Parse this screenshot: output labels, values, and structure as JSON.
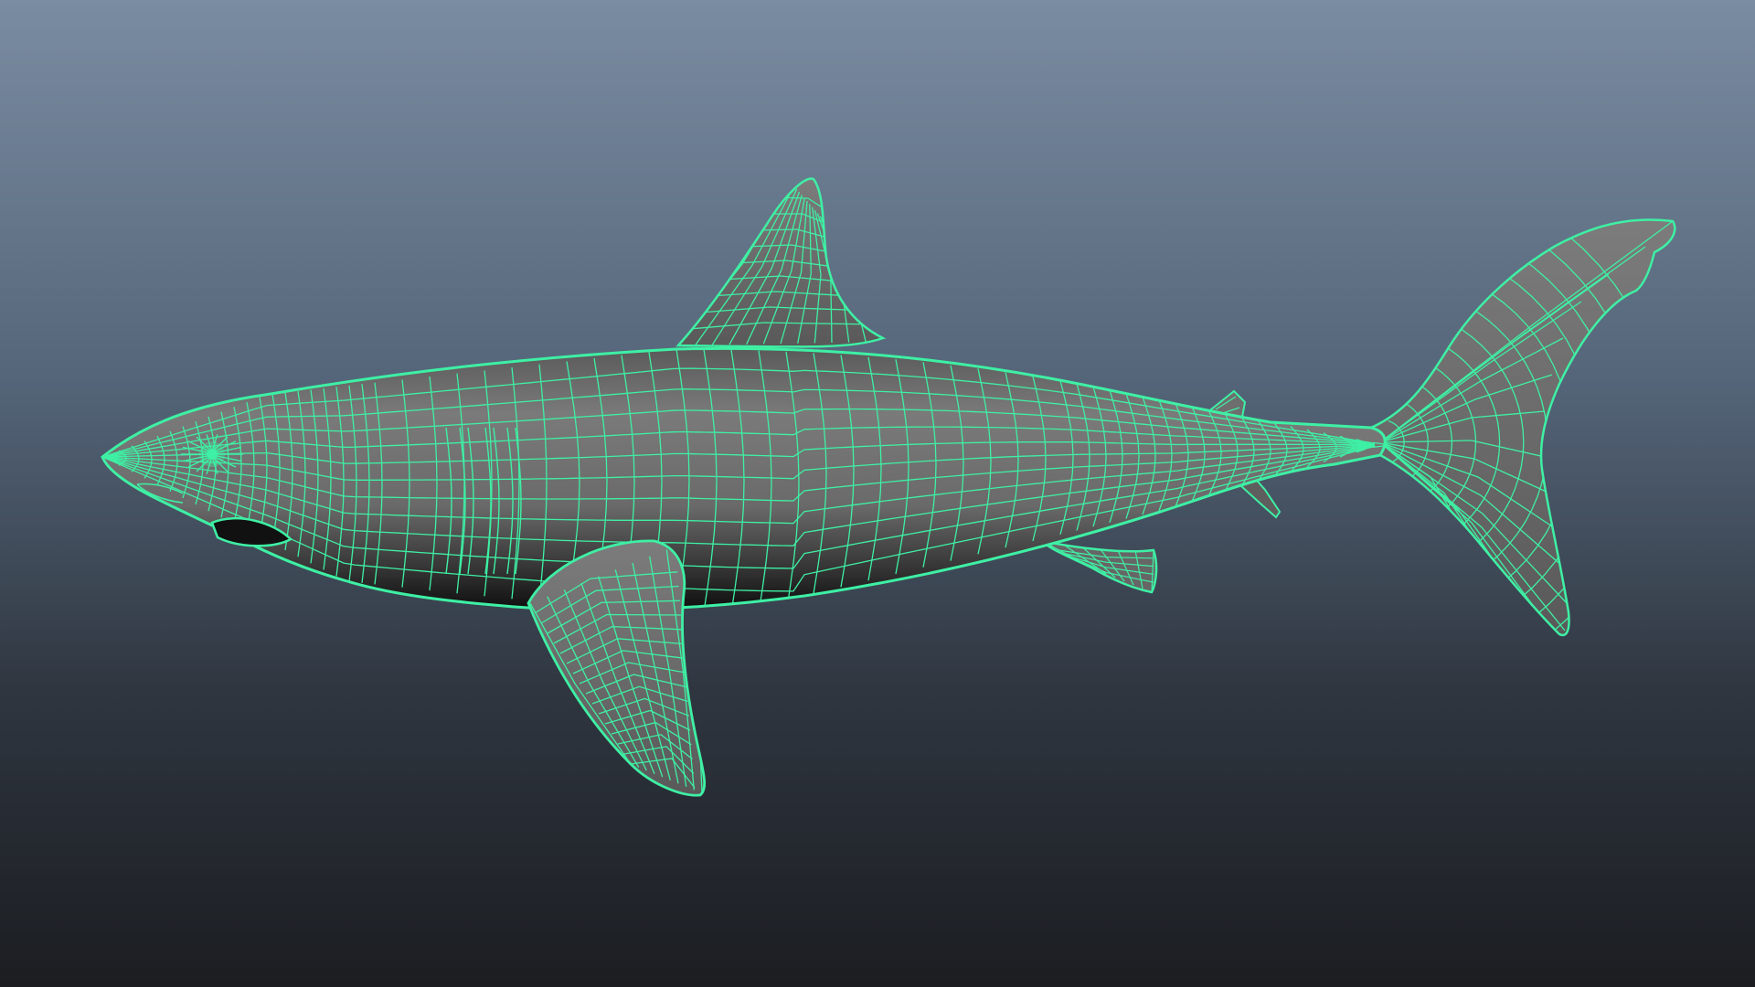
{
  "viewport": {
    "background_top": "#7a8ca1",
    "background_bottom": "#1b1d21"
  },
  "model": {
    "subject": "shark",
    "display_mode": "wireframe-on-shaded",
    "surface_color": "#707070",
    "surface_dark": "#1e1e1e",
    "wire_color": "#3ef0a4"
  }
}
